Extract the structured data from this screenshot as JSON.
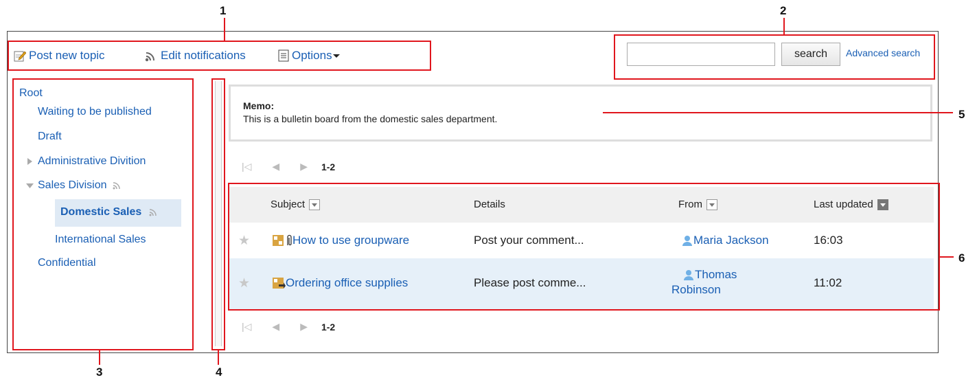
{
  "callouts": {
    "n1": "1",
    "n2": "2",
    "n3": "3",
    "n4": "4",
    "n5": "5",
    "n6": "6"
  },
  "toolbar": {
    "post_new_topic": "Post new topic",
    "edit_notifications": "Edit notifications",
    "options": "Options"
  },
  "search": {
    "button": "search",
    "advanced": "Advanced search",
    "value": ""
  },
  "tree": {
    "root": "Root",
    "waiting": "Waiting to be published",
    "draft": "Draft",
    "admin": "Administrative Divition",
    "sales": "Sales Division",
    "domestic": "Domestic Sales",
    "international": "International Sales",
    "confidential": "Confidential"
  },
  "memo": {
    "title": "Memo:",
    "text": "This is a bulletin board from the domestic sales department."
  },
  "pager": {
    "range": "1-2"
  },
  "table": {
    "headers": {
      "subject": "Subject",
      "details": "Details",
      "from": "From",
      "last_updated": "Last updated"
    },
    "rows": [
      {
        "subject": "How to use groupware",
        "details": "Post your comment...",
        "from": "Maria Jackson",
        "from_line2": "",
        "updated": "16:03"
      },
      {
        "subject": "Ordering office supplies",
        "details": "Please post comme...",
        "from": "Thomas",
        "from_line2": "Robinson",
        "updated": "11:02"
      }
    ]
  },
  "colors": {
    "callout_red": "#e0161d",
    "link_blue": "#1a5fb4",
    "selected_bg": "#dfeaf5",
    "row_highlight": "#e6f0f9"
  },
  "icons": [
    "edit-icon",
    "notification-icon",
    "options-icon",
    "chevron-down-icon",
    "expand-arrow-icon",
    "collapse-arrow-icon",
    "star-icon",
    "topic-icon",
    "attachment-icon",
    "user-icon",
    "sort-icon"
  ]
}
